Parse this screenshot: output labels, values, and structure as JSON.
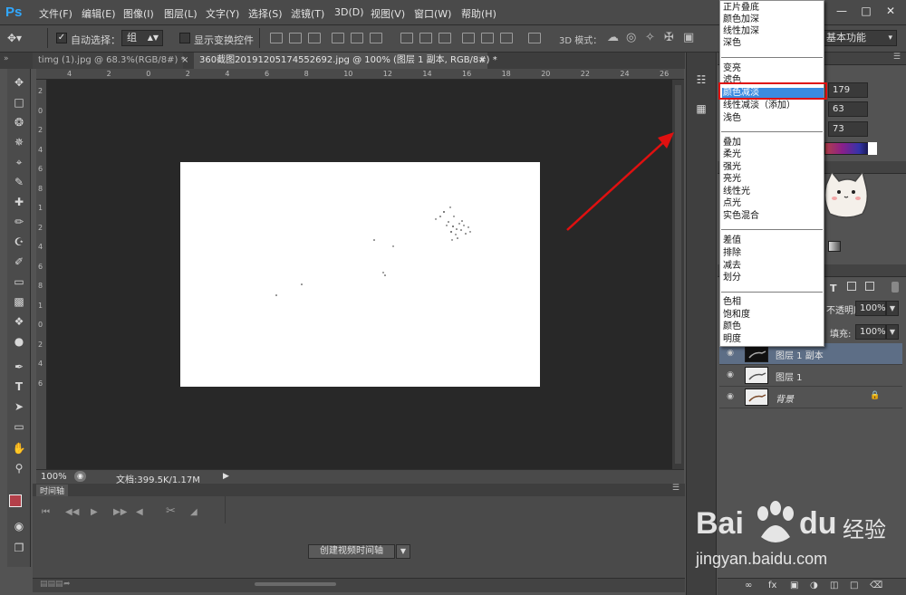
{
  "app": {
    "logo": "Ps",
    "menus": [
      "文件(F)",
      "编辑(E)",
      "图像(I)",
      "图层(L)",
      "文字(Y)",
      "选择(S)",
      "滤镜(T)",
      "3D(D)",
      "视图(V)",
      "窗口(W)",
      "帮助(H)"
    ],
    "window_controls": [
      "minimize-icon",
      "maximize-icon",
      "close-icon"
    ]
  },
  "options": {
    "auto_select_label": "自动选择：",
    "auto_select_value": "组",
    "show_transform_label": "显示变换控件",
    "mode_3d_label": "3D 模式：",
    "workspace_label": "基本功能"
  },
  "tabs": [
    {
      "label": "timg (1).jpg @ 68.3%(RGB/8#) *"
    },
    {
      "label": "360截图20191205174552692.jpg @ 100% (图层 1 副本, RGB/8#) *"
    }
  ],
  "rulers": {
    "top": [
      "4",
      "2",
      "0",
      "2",
      "4",
      "6",
      "8",
      "10",
      "12",
      "14",
      "16",
      "18",
      "20",
      "22",
      "24",
      "26"
    ],
    "left": [
      "2",
      "0",
      "2",
      "4",
      "6",
      "8",
      "1",
      "2",
      "4",
      "6",
      "8",
      "1",
      "0",
      "2",
      "4",
      "6"
    ]
  },
  "status": {
    "zoom": "100%",
    "doc_info": "文档:399.5K/1.17M"
  },
  "timeline": {
    "title": "时间轴",
    "create_button": "创建视频时间轴"
  },
  "color_panel": {
    "r": "179",
    "g": "63",
    "b": "73",
    "foreground": "#b33f49"
  },
  "layers_panel": {
    "opacity_label": "不透明度:",
    "opacity_value": "100%",
    "fill_label": "填充:",
    "fill_value": "100%",
    "layers": [
      {
        "name": "图层 1 副本",
        "selected": true,
        "locked": false
      },
      {
        "name": "图层 1",
        "selected": false,
        "locked": false
      },
      {
        "name": "背景",
        "selected": false,
        "locked": true
      }
    ]
  },
  "blend_menu": {
    "group1": [
      "正片叠底",
      "颜色加深",
      "线性加深",
      "深色"
    ],
    "group2": [
      "变亮",
      "滤色",
      "颜色减淡",
      "线性减淡（添加）",
      "浅色"
    ],
    "group3": [
      "叠加",
      "柔光",
      "强光",
      "亮光",
      "线性光",
      "点光",
      "实色混合"
    ],
    "group4": [
      "差值",
      "排除",
      "减去",
      "划分"
    ],
    "group5": [
      "色相",
      "饱和度",
      "颜色",
      "明度"
    ],
    "highlighted": "颜色减淡"
  },
  "watermark": {
    "brand": "Bai",
    "brand2": "du",
    "cn": "经验",
    "url": "jingyan.baidu.com"
  },
  "colors": {
    "accent_highlight": "#3b8be0",
    "annotation_red": "#e01010"
  }
}
